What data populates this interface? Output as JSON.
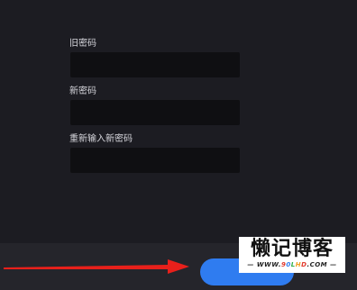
{
  "form": {
    "old_password_label": "旧密码",
    "new_password_label": "新密码",
    "confirm_password_label": "重新输入新密码",
    "old_password_value": "",
    "new_password_value": "",
    "confirm_password_value": ""
  },
  "footer": {
    "confirm_button_label": ""
  },
  "watermark": {
    "title": "懒记博客",
    "url_prefix": "— WWW.",
    "url_p1": "9",
    "url_p2": "0",
    "url_p3": "L",
    "url_p4": "H",
    "url_p5": "D",
    "url_suffix": ".COM —"
  },
  "colors": {
    "background": "#1c1c22",
    "input_background": "#0f0f12",
    "footer_background": "#25252b",
    "accent": "#2f7cf0",
    "arrow": "#e8201b"
  }
}
